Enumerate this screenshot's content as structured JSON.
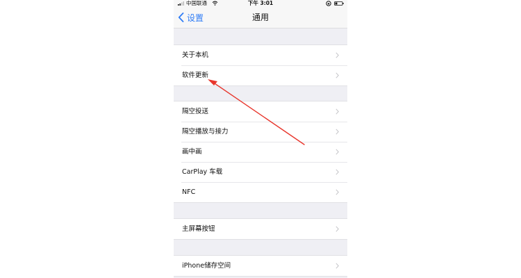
{
  "status_bar": {
    "carrier": "中国联通",
    "time": "下午 3:01"
  },
  "nav": {
    "back_label": "设置",
    "title": "通用"
  },
  "groups": [
    {
      "items": [
        {
          "label": "关于本机"
        },
        {
          "label": "软件更新"
        }
      ]
    },
    {
      "items": [
        {
          "label": "隔空投送"
        },
        {
          "label": "隔空播放与接力"
        },
        {
          "label": "画中画"
        },
        {
          "label": "CarPlay 车载"
        },
        {
          "label": "NFC"
        }
      ]
    },
    {
      "items": [
        {
          "label": "主屏幕按钮"
        }
      ]
    },
    {
      "items": [
        {
          "label": "iPhone储存空间"
        }
      ]
    }
  ],
  "colors": {
    "accent": "#2f7cf6",
    "annotation_arrow": "#e8362c",
    "background": "#efeff4"
  },
  "icons": {
    "signal": "signal-icon",
    "wifi": "wifi-icon",
    "lock": "lock-rotation-icon",
    "battery": "battery-icon",
    "back": "chevron-left-icon",
    "row": "chevron-right-icon"
  }
}
